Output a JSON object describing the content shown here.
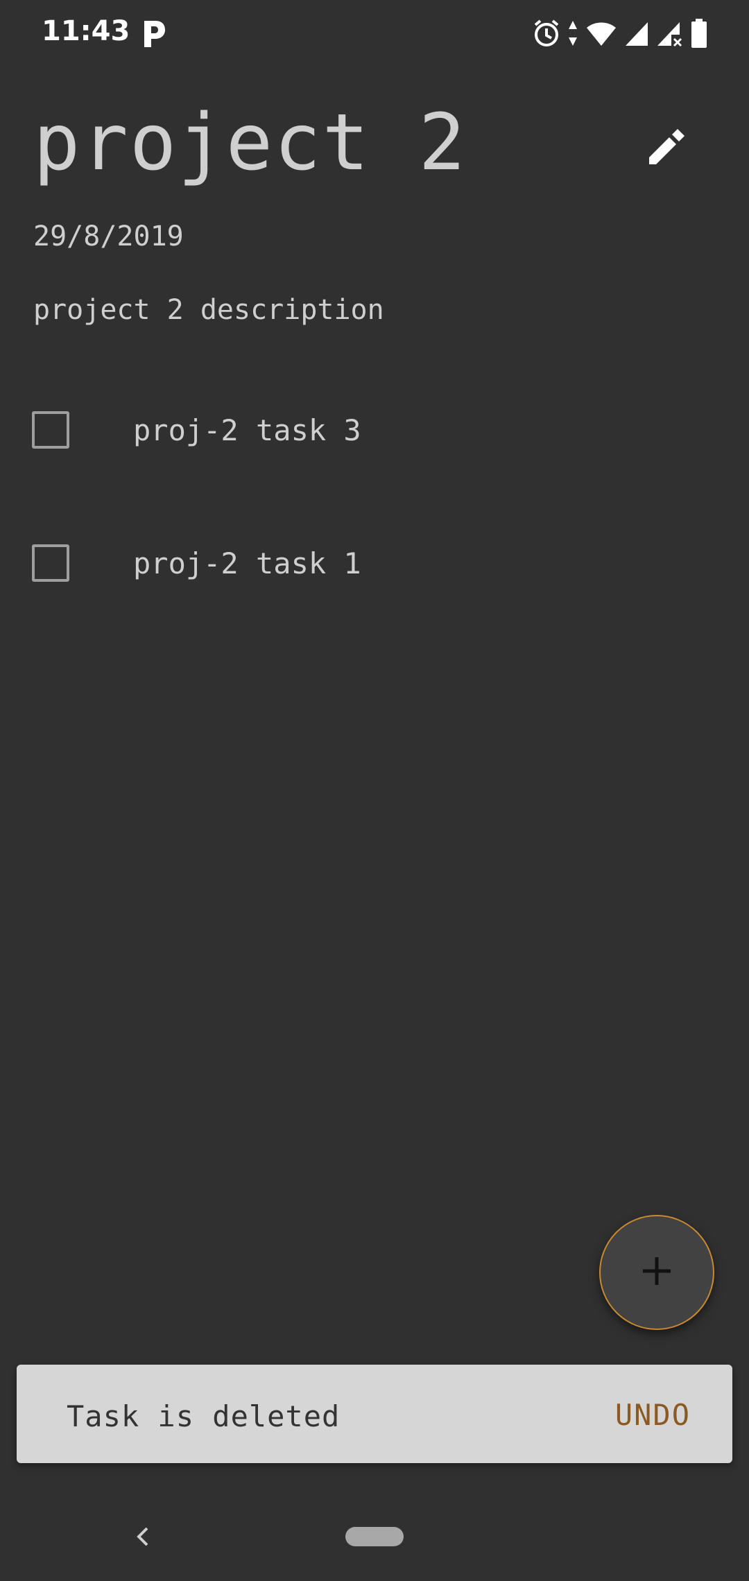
{
  "status_bar": {
    "time": "11:43",
    "notification_icon": "p-icon",
    "icons": [
      "alarm-icon",
      "data-arrows-icon",
      "wifi-icon",
      "signal-icon",
      "signal-no-data-icon",
      "battery-icon"
    ]
  },
  "project": {
    "title": "project 2",
    "date": "29/8/2019",
    "description": "project 2 description"
  },
  "tasks": [
    {
      "label": "proj-2 task 3",
      "checked": false
    },
    {
      "label": "proj-2 task 1",
      "checked": false
    }
  ],
  "fab": {
    "icon": "plus-icon"
  },
  "snackbar": {
    "message": "Task is deleted",
    "action": "UNDO"
  },
  "colors": {
    "background": "#303030",
    "text": "#cfcfcf",
    "accent": "#c98a2f",
    "snackbar_bg": "#d6d6d6",
    "snackbar_action": "#8a5a22"
  }
}
